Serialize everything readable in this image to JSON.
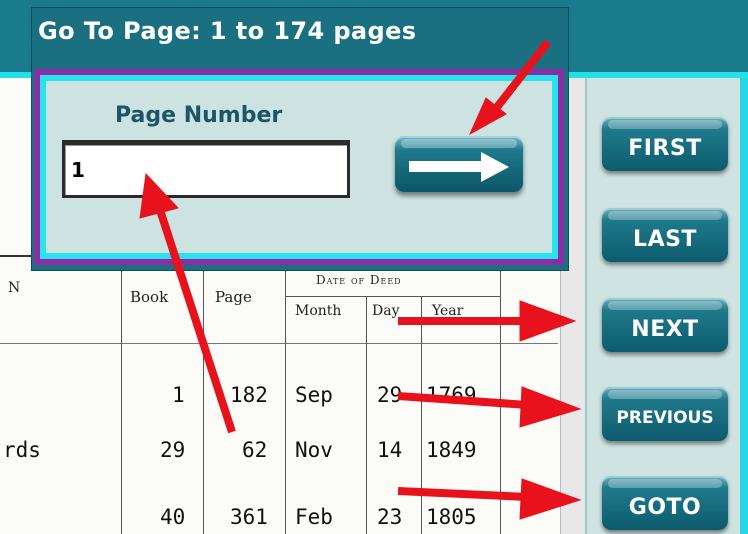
{
  "dialog": {
    "title": "Go To Page:  1 to 174 pages",
    "field_label": "Page Number",
    "page_value": "1"
  },
  "nav": {
    "first": "FIRST",
    "last": "LAST",
    "next": "NEXT",
    "previous": "PREVIOUS",
    "goto": "GOTO"
  },
  "document": {
    "header_book": "Book",
    "header_page": "Page",
    "header_date": "Date of Deed",
    "header_month": "Month",
    "header_day": "Day",
    "header_year": "Year",
    "left_fragment_n": "N",
    "left_fragment_rds": "rds",
    "rows": [
      {
        "book": "1",
        "page": "182",
        "month": "Sep",
        "day": "29",
        "year": "1769"
      },
      {
        "book": "29",
        "page": "62",
        "month": "Nov",
        "day": "14",
        "year": "1849"
      },
      {
        "book": "40",
        "page": "361",
        "month": "Feb",
        "day": "23",
        "year": "1805"
      }
    ]
  },
  "colors": {
    "teal": "#1a7b8c",
    "cyan": "#27e3ee",
    "purple": "#8a2fa3",
    "arrow_red": "#e8121c"
  },
  "icons": {
    "go_button": "right-arrow-icon"
  }
}
